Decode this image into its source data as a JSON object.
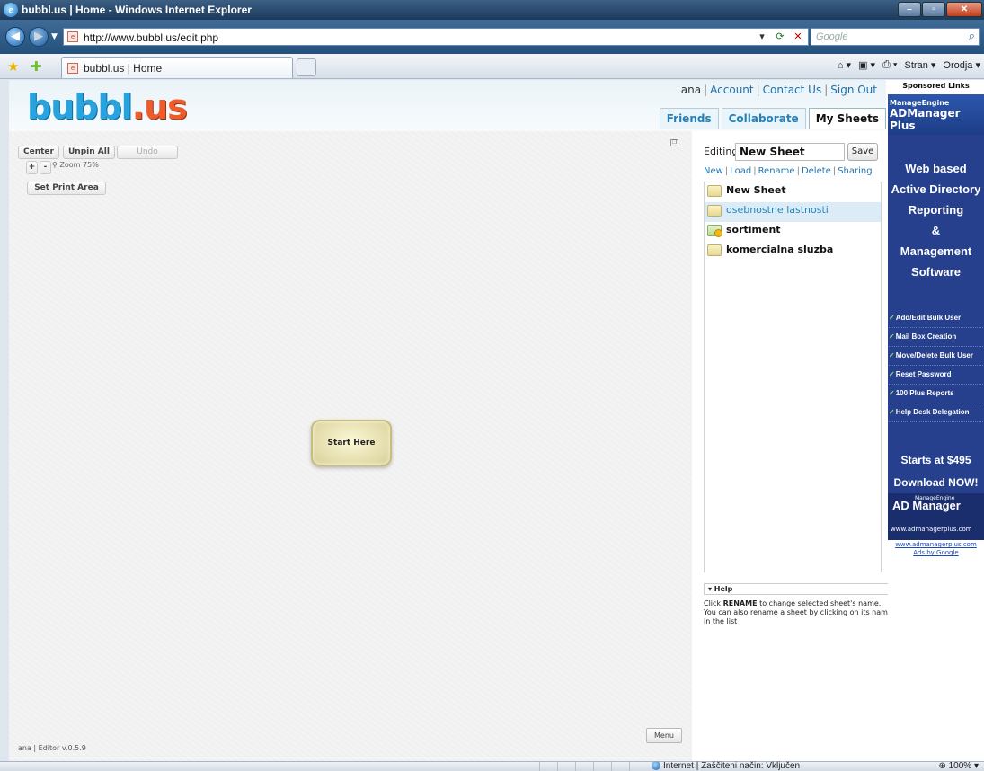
{
  "browser": {
    "window_title": "bubbl.us | Home - Windows Internet Explorer",
    "url": "http://www.bubbl.us/edit.php",
    "search_placeholder": "Google",
    "tab_title": "bubbl.us | Home",
    "commands": [
      "Stran ▾",
      "Orodja ▾"
    ],
    "status_zone": "Internet | Zaščiteni način: Vključen",
    "zoom": "100%"
  },
  "site": {
    "logo": {
      "text": "bubbl",
      "dot": ".",
      "suffix": "us"
    },
    "user_links": {
      "user": "ana",
      "account": "Account",
      "contact": "Contact Us",
      "signout": "Sign Out"
    },
    "tabs": [
      "Friends",
      "Collaborate",
      "My Sheets"
    ],
    "active_tab": "My Sheets"
  },
  "editor": {
    "center_label": "Center",
    "unpin_label": "Unpin All",
    "undo_label": "Undo",
    "zoom_in": "+",
    "zoom_out": "-",
    "zoom_text": "Zoom 75%",
    "print_area_label": "Set Print Area",
    "bubble_text": "Start Here",
    "footer": "ana | Editor v.0.5.9",
    "menu_label": "Menu"
  },
  "sheets": {
    "editing_label": "Editing",
    "current_name": "New Sheet",
    "save_label": "Save",
    "actions": [
      "New",
      "Load",
      "Rename",
      "Delete",
      "Sharing"
    ],
    "items": [
      {
        "name": "New Sheet",
        "icon": "folder-icon"
      },
      {
        "name": "osebnostne lastnosti",
        "icon": "folder-icon"
      },
      {
        "name": "sortiment",
        "icon": "shared-folder-icon"
      },
      {
        "name": "komercialna sluzba",
        "icon": "folder-icon"
      }
    ],
    "selected_index": 1
  },
  "help": {
    "header": "▾ Help",
    "text_pre": "Click ",
    "text_bold": "RENAME",
    "text_post": " to change selected sheet's name. You can also rename a sheet by clicking on its name in the list"
  },
  "ad": {
    "header": "Sponsored Links",
    "brand_small": "ManageEngine",
    "brand_large": "ADManager Plus",
    "headline": [
      "Web based",
      "Active Directory",
      "Reporting",
      "&",
      "Management",
      "Software"
    ],
    "bullets": [
      "Add/Edit Bulk User",
      "Mail Box Creation",
      "Move/Delete Bulk User",
      "Reset Password",
      "100 Plus Reports",
      "Help Desk Delegation"
    ],
    "cta": [
      "Starts at $495",
      "Download NOW!"
    ],
    "logo_small": "ManageEngine",
    "logo_text": "AD Manager",
    "logo_url": "www.admanagerplus.com",
    "link_url": "www.admanagerplus.com",
    "link_google": "Ads by Google"
  }
}
